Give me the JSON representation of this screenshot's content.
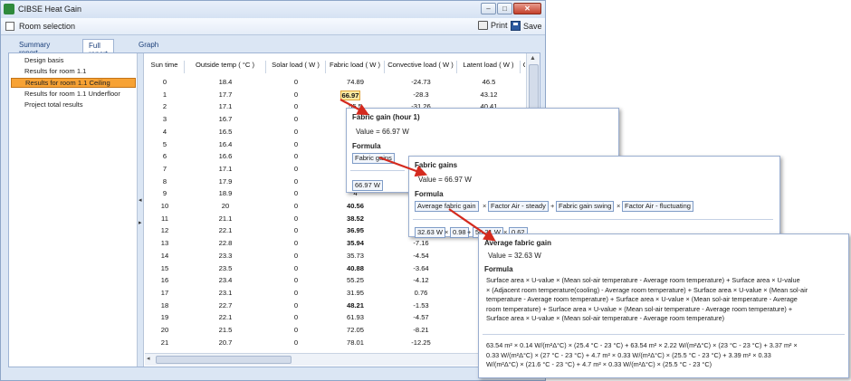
{
  "window": {
    "title": "CIBSE Heat Gain",
    "minimize": "–",
    "maximize": "□",
    "close": "✕"
  },
  "toolbar": {
    "title": "Room selection",
    "print": "Print",
    "save": "Save"
  },
  "tabs": [
    "Summary report",
    "Full report",
    "Graph"
  ],
  "tree": [
    "Design basis",
    "Results for room  1.1",
    "Results for room  1.1 Ceiling",
    "Results for room  1.1 Underfloor",
    "Project total results"
  ],
  "table": {
    "columns": [
      "Sun time",
      "Outside temp ( °C )",
      "Solar load ( W )",
      "Fabric load ( W )",
      "Convective load ( W )",
      "Latent load ( W )",
      "Cas"
    ],
    "rows": [
      [
        "0",
        "18.4",
        "0",
        "74.89",
        "-24.73",
        "46.5"
      ],
      [
        "1",
        "17.7",
        "0",
        "66.97",
        "-28.3",
        "43.12"
      ],
      [
        "2",
        "17.1",
        "0",
        "55.5",
        "-31.26",
        "40.41"
      ],
      [
        "3",
        "16.7",
        "0",
        "4",
        "",
        ""
      ],
      [
        "4",
        "16.5",
        "0",
        "4",
        "",
        ""
      ],
      [
        "5",
        "16.4",
        "0",
        "1",
        "",
        ""
      ],
      [
        "6",
        "16.6",
        "0",
        "1",
        "",
        ""
      ],
      [
        "7",
        "17.1",
        "0",
        "",
        "",
        ""
      ],
      [
        "8",
        "17.9",
        "0",
        "4",
        "",
        ""
      ],
      [
        "9",
        "18.9",
        "0",
        "4",
        "",
        ""
      ],
      [
        "10",
        "20",
        "0",
        "40.56",
        "",
        ""
      ],
      [
        "11",
        "21.1",
        "0",
        "38.52",
        "",
        ""
      ],
      [
        "12",
        "22.1",
        "0",
        "36.95",
        "",
        ""
      ],
      [
        "13",
        "22.8",
        "0",
        "35.94",
        "-7.16",
        ""
      ],
      [
        "14",
        "23.3",
        "0",
        "35.73",
        "-4.54",
        ""
      ],
      [
        "15",
        "23.5",
        "0",
        "40.88",
        "-3.64",
        ""
      ],
      [
        "16",
        "23.4",
        "0",
        "55.25",
        "-4.12",
        ""
      ],
      [
        "17",
        "23.1",
        "0",
        "31.95",
        "0.76",
        ""
      ],
      [
        "18",
        "22.7",
        "0",
        "48.21",
        "-1.53",
        ""
      ],
      [
        "19",
        "22.1",
        "0",
        "61.93",
        "-4.57",
        ""
      ],
      [
        "20",
        "21.5",
        "0",
        "72.05",
        "-8.21",
        ""
      ],
      [
        "21",
        "20.7",
        "0",
        "78.01",
        "-12.25",
        ""
      ]
    ]
  },
  "popup1": {
    "title": "Fabric gain (hour 1)",
    "value": "Value = 66.97 W",
    "formula_label": "Formula",
    "chip": "Fabric gains",
    "result_chip": "66.97 W"
  },
  "popup2": {
    "title": "Fabric gains",
    "value": "Value = 66.97 W",
    "formula_label": "Formula",
    "chips": [
      "Average fabric gain",
      "Factor Air - steady",
      "Fabric gain swing",
      "Factor Air - fluctuating"
    ],
    "op": "×",
    "op_plus": "+",
    "values": [
      "32.63 W",
      "0.98",
      "56.21 W",
      "0.62"
    ]
  },
  "popup3": {
    "title": "Average fabric gain",
    "value": "Value = 32.63 W",
    "formula_label": "Formula",
    "formula_lines": [
      "Surface area × U-value × (Mean sol-air temperature - Average room temperature) + Surface area × U-value",
      "× (Adjacent room temperature(cooling) - Average room temperature) + Surface area × U-value × (Mean sol-air",
      "temperature - Average room temperature) + Surface area × U-value × (Mean sol-air temperature - Average",
      "room temperature) + Surface area × U-value × (Mean sol-air temperature - Average room temperature) +",
      "Surface area × U-value × (Mean sol-air temperature - Average room temperature)"
    ],
    "value_lines": [
      "63.54 m² × 0.14 W/(m²Δ°C) × (25.4 °C - 23 °C) + 63.54 m² × 2.22 W/(m²Δ°C) × (23 °C - 23 °C) + 3.37 m² ×",
      "0.33 W/(m²Δ°C) × (27 °C - 23 °C) + 4.7 m² × 0.33 W/(m²Δ°C) × (25.5 °C - 23 °C) + 3.39 m² × 0.33",
      "W/(m²Δ°C) × (21.6 °C - 23 °C) + 4.7 m² × 0.33 W/(m²Δ°C) × (25.5 °C - 23 °C)"
    ]
  }
}
